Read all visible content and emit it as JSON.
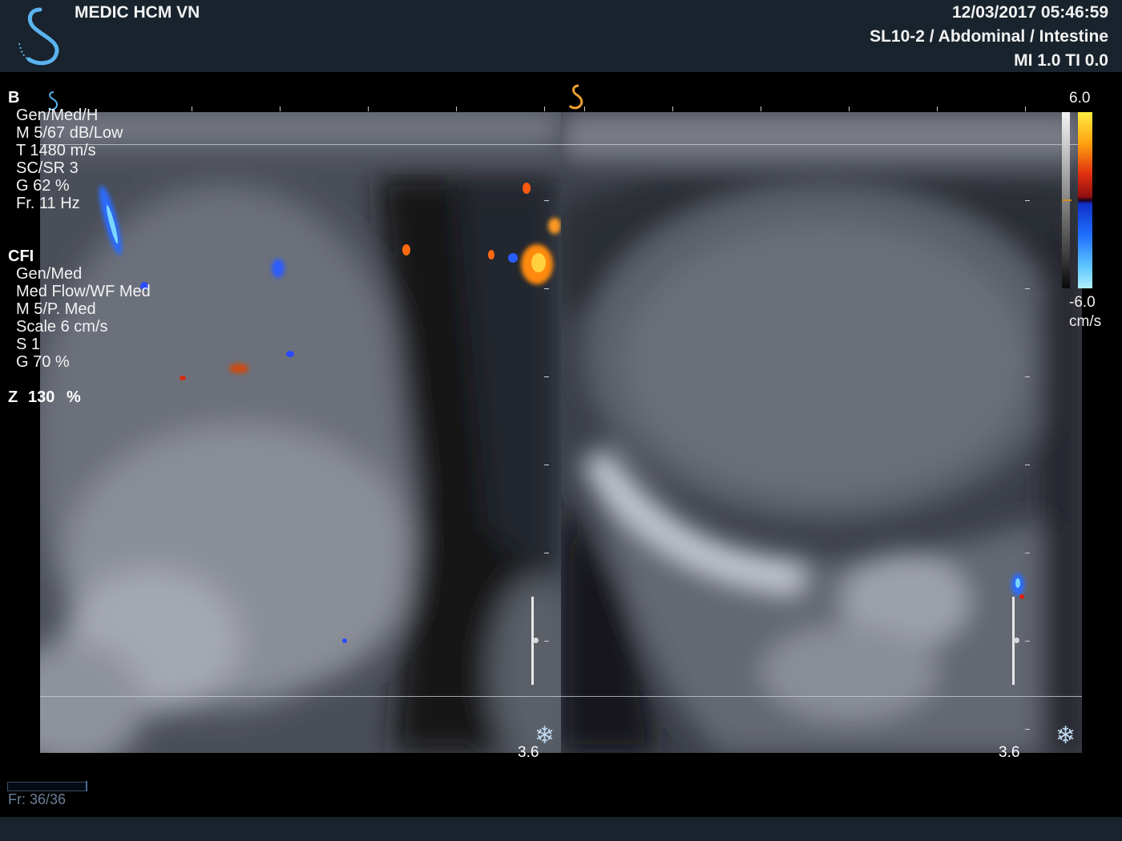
{
  "header": {
    "institution": "MEDIC HCM VN",
    "datetime": "12/03/2017 05:46:59",
    "probe_preset": "SL10-2 / Abdominal / Intestine",
    "mi_ti": "MI 1.0  TI 0.0"
  },
  "b_mode": {
    "title": "B",
    "params": [
      "Gen/Med/H",
      "M 5/67 dB/Low",
      "T 1480 m/s",
      "SC/SR 3",
      "G 62 %",
      "Fr. 11 Hz"
    ]
  },
  "cfi": {
    "title": "CFI",
    "params": [
      "Gen/Med",
      "Med Flow/WF Med",
      "M 5/P. Med",
      "Scale 6 cm/s",
      "S 1",
      "G 70 %"
    ]
  },
  "zoom": {
    "label": "Z",
    "value": "130",
    "unit": "%"
  },
  "color_scale": {
    "max": "6.0",
    "min": "-6.0",
    "unit": "cm/s"
  },
  "left_image": {
    "depth": "3.6"
  },
  "right_image": {
    "depth": "3.6"
  },
  "cine": {
    "frame_text": "Fr: 36/36",
    "progress": 1.0
  },
  "icons": [
    "logo-s-icon",
    "probe-orientation-icon",
    "active-image-marker-icon",
    "freeze-snowflake-icon"
  ],
  "colors": {
    "header_bg": "#18232d",
    "logo": "#5ab4ee",
    "active_marker": "#f0a030"
  }
}
